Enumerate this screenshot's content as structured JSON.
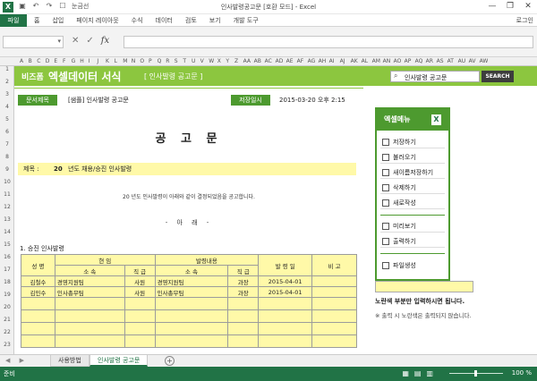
{
  "window": {
    "title": "인사발령공고문 [호환 모드] - Excel",
    "qat_label": "눈금선",
    "min": "—",
    "max": "❐",
    "close": "✕"
  },
  "ribbon": {
    "file": "파일",
    "tabs": [
      "홈",
      "삽입",
      "페이지 레이아웃",
      "수식",
      "데이터",
      "검토",
      "보기",
      "개발 도구"
    ],
    "login": "로그인"
  },
  "formula": {
    "cancel": "✕",
    "enter": "✓",
    "fx": "fx"
  },
  "columns": [
    "A",
    "B",
    "C",
    "D",
    "E",
    "F",
    "G",
    "H",
    "I",
    "J",
    "K",
    "L",
    "M",
    "N",
    "O",
    "P",
    "Q",
    "R",
    "S",
    "T",
    "U",
    "V",
    "W",
    "X",
    "Y",
    "Z",
    "AA",
    "AB",
    "AC",
    "AD",
    "AE",
    "AF",
    "AG",
    "AH",
    "AI",
    "AJ",
    "AK",
    "AL",
    "AM",
    "AN",
    "AO",
    "AP",
    "AQ",
    "AR",
    "AS",
    "AT",
    "AU",
    "AV",
    "AW"
  ],
  "rows": [
    "1",
    "2",
    "3",
    "4",
    "5",
    "6",
    "7",
    "8",
    "9",
    "10",
    "11",
    "12",
    "13",
    "14",
    "15",
    "16",
    "17",
    "18",
    "19",
    "20",
    "21",
    "22",
    "23"
  ],
  "banner": {
    "brand": "비즈폼",
    "title": "엑셀데이터 서식",
    "tag": "[ 인사발령 공고문 ]",
    "search_value": "인사발령 공고문",
    "search_btn": "SEARCH"
  },
  "doc": {
    "label_name": "문서제목",
    "name": "[샘플] 인사발령 공고문",
    "label_date": "저장일시",
    "date": "2015-03-20  오후 2:15"
  },
  "notice": {
    "heading": "공 고 문",
    "subject_label": "제목 :",
    "year": "20",
    "subject": "년도 채용/승진 인사발령",
    "statement": "20   년도 인사발령이 아래와 같이 결정되었음을 공고합니다.",
    "below": "- 아       래 -",
    "section": "1. 승진 인사발령"
  },
  "table": {
    "headers": {
      "name": "성 명",
      "current": "현     임",
      "appoint": "발령내용",
      "dept": "소 속",
      "rank": "직 급",
      "date": "발 령 일",
      "note": "비 고"
    },
    "rows": [
      {
        "name": "김철수",
        "cur_dept": "경영지원팀",
        "cur_rank": "사원",
        "new_dept": "경영지원팀",
        "new_rank": "과장",
        "date": "2015-04-01",
        "note": ""
      },
      {
        "name": "김민수",
        "cur_dept": "인사총무팀",
        "cur_rank": "사원",
        "new_dept": "인사총무팀",
        "new_rank": "과장",
        "date": "2015-04-01",
        "note": ""
      }
    ]
  },
  "menu": {
    "title": "엑셀메뉴",
    "items": [
      "저장하기",
      "불러오기",
      "새이름저장하기",
      "삭제하기",
      "새로작성",
      "미리보기",
      "출력하기",
      "파일생성"
    ]
  },
  "hints": {
    "h1": "노란색 부분만 입력하시면 됩니다.",
    "h2": "※ 출력 시 노란색은 출력되지 않습니다."
  },
  "sheets": [
    "사용방법",
    "인사발령 공고문"
  ],
  "status": {
    "ready": "준비",
    "zoom": "100 %"
  },
  "colors": {
    "excel_green": "#217346",
    "banner": "#8cc63f",
    "label": "#4d9a2f",
    "input_yellow": "#fff9a8"
  }
}
